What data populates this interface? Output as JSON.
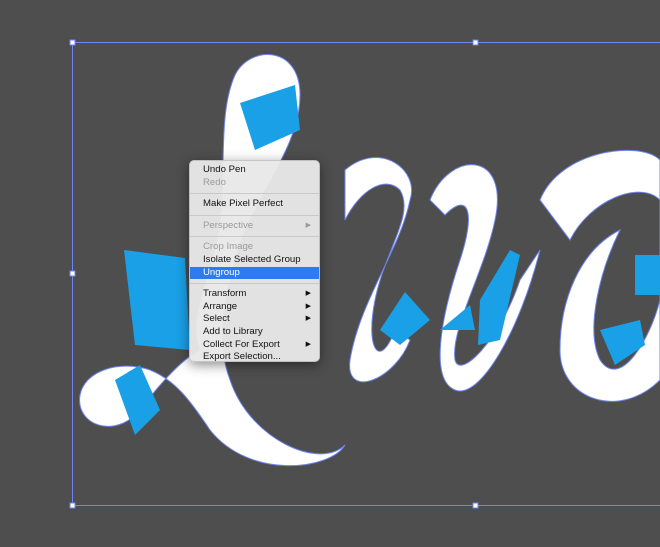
{
  "canvas": {
    "background": "#4e4e4e",
    "accent_blue": "#1aa0e6",
    "selection_color": "#5b7cf5"
  },
  "context_menu": {
    "groups": [
      [
        {
          "label": "Undo Pen",
          "enabled": true
        },
        {
          "label": "Redo",
          "enabled": false
        }
      ],
      [
        {
          "label": "Make Pixel Perfect",
          "enabled": true
        }
      ],
      [
        {
          "label": "Perspective",
          "enabled": false,
          "submenu": true
        }
      ],
      [
        {
          "label": "Crop Image",
          "enabled": false
        },
        {
          "label": "Isolate Selected Group",
          "enabled": true
        },
        {
          "label": "Ungroup",
          "enabled": true,
          "highlighted": true
        }
      ],
      [
        {
          "label": "Transform",
          "enabled": true,
          "submenu": true
        },
        {
          "label": "Arrange",
          "enabled": true,
          "submenu": true
        },
        {
          "label": "Select",
          "enabled": true,
          "submenu": true
        },
        {
          "label": "Add to Library",
          "enabled": true
        },
        {
          "label": "Collect For Export",
          "enabled": true,
          "submenu": true
        },
        {
          "label": "Export Selection...",
          "enabled": true
        }
      ]
    ],
    "submenu_glyph": "▶"
  }
}
